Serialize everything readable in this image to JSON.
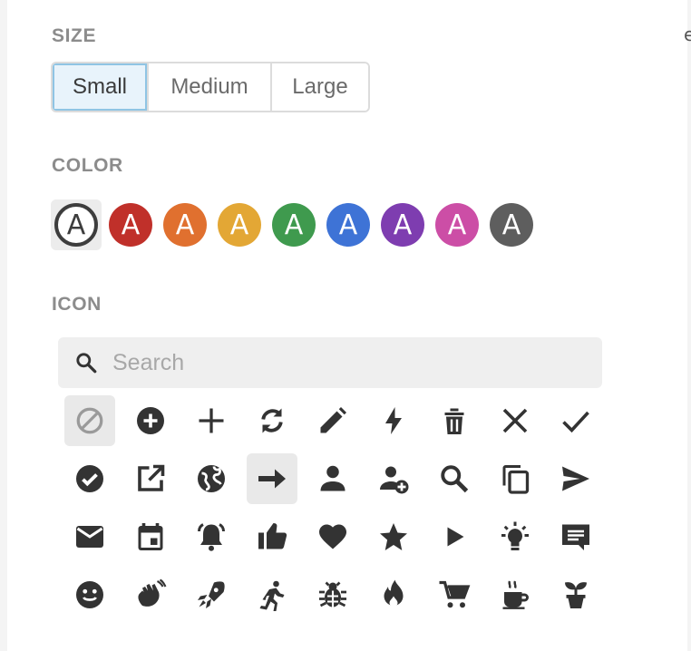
{
  "size": {
    "label": "SIZE",
    "options": [
      "Small",
      "Medium",
      "Large"
    ],
    "selected": "Small"
  },
  "color": {
    "label": "COLOR",
    "glyph": "A",
    "swatches": [
      {
        "name": "default",
        "hex": "#3d3d3d",
        "selected": true
      },
      {
        "name": "red",
        "hex": "#c0302a"
      },
      {
        "name": "orange",
        "hex": "#e0702f"
      },
      {
        "name": "yellow",
        "hex": "#e3a735"
      },
      {
        "name": "green",
        "hex": "#3f9a4e"
      },
      {
        "name": "blue",
        "hex": "#3e73d6"
      },
      {
        "name": "purple",
        "hex": "#7e3db0"
      },
      {
        "name": "pink",
        "hex": "#cc4ea6"
      },
      {
        "name": "gray",
        "hex": "#5e5e5e"
      }
    ]
  },
  "icon": {
    "label": "ICON",
    "search_placeholder": "Search",
    "selected": "arrow-right",
    "items": [
      "none",
      "add-circle",
      "plus",
      "sync",
      "pencil",
      "bolt",
      "trash",
      "close",
      "check",
      "check-circle",
      "open-external",
      "globe",
      "arrow-right",
      "person",
      "person-add",
      "search",
      "copy",
      "send",
      "mail",
      "calendar",
      "bell",
      "thumbs-up",
      "heart",
      "star",
      "play",
      "lightbulb",
      "comment",
      "smile",
      "wave",
      "rocket",
      "run",
      "bug",
      "fire",
      "cart",
      "coffee",
      "plant"
    ]
  }
}
